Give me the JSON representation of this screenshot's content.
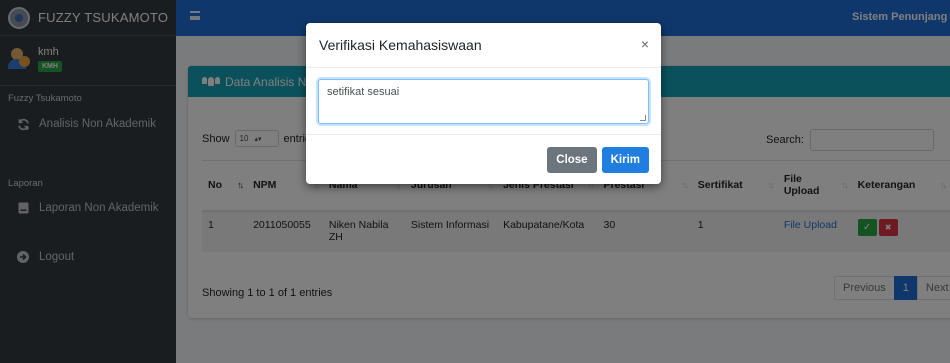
{
  "brand": {
    "title": "FUZZY TSUKAMOTO"
  },
  "user": {
    "name": "kmh",
    "badge": "KMH"
  },
  "sidebar": {
    "section1": "Fuzzy Tsukamoto",
    "item1": "Analisis Non Akademik",
    "section2": "Laporan",
    "item2": "Laporan Non Akademik",
    "logout": "Logout"
  },
  "topbar": {
    "title": "Sistem Penunjang"
  },
  "card": {
    "title": "Data Analisis Non Akademik"
  },
  "table_controls": {
    "show_label": "Show",
    "length_value": "10",
    "entries_label": "entries",
    "search_label": "Search:",
    "info": "Showing 1 to 1 of 1 entries"
  },
  "table": {
    "headers": [
      "No",
      "NPM",
      "Nama",
      "Jurusan",
      "Jenis Prestasi",
      "Prestasi",
      "Sertifikat",
      "File Upload",
      "Keterangan"
    ],
    "rows": [
      [
        "1",
        "2011050055",
        "Niken Nabila ZH",
        "Sistem Informasi",
        "Kabupatane/Kota",
        "30",
        "1",
        "File Upload",
        ""
      ]
    ]
  },
  "pagination": {
    "previous": "Previous",
    "current": "1",
    "next": "Next"
  },
  "modal": {
    "title": "Verifikasi Kemahasiswaan",
    "close_symbol": "×",
    "textarea_value": "setifikat sesuai",
    "close_label": "Close",
    "submit_label": "Kirim"
  },
  "colors": {
    "navbar": "#1f6fd6",
    "sidebar": "#343a40",
    "card_header": "#17a2b8",
    "success": "#28a745",
    "danger": "#dc3545"
  },
  "icons": [
    "hamburger-icon",
    "users-icon",
    "sync-icon",
    "report-icon",
    "logout-icon",
    "check-icon",
    "times-icon"
  ]
}
